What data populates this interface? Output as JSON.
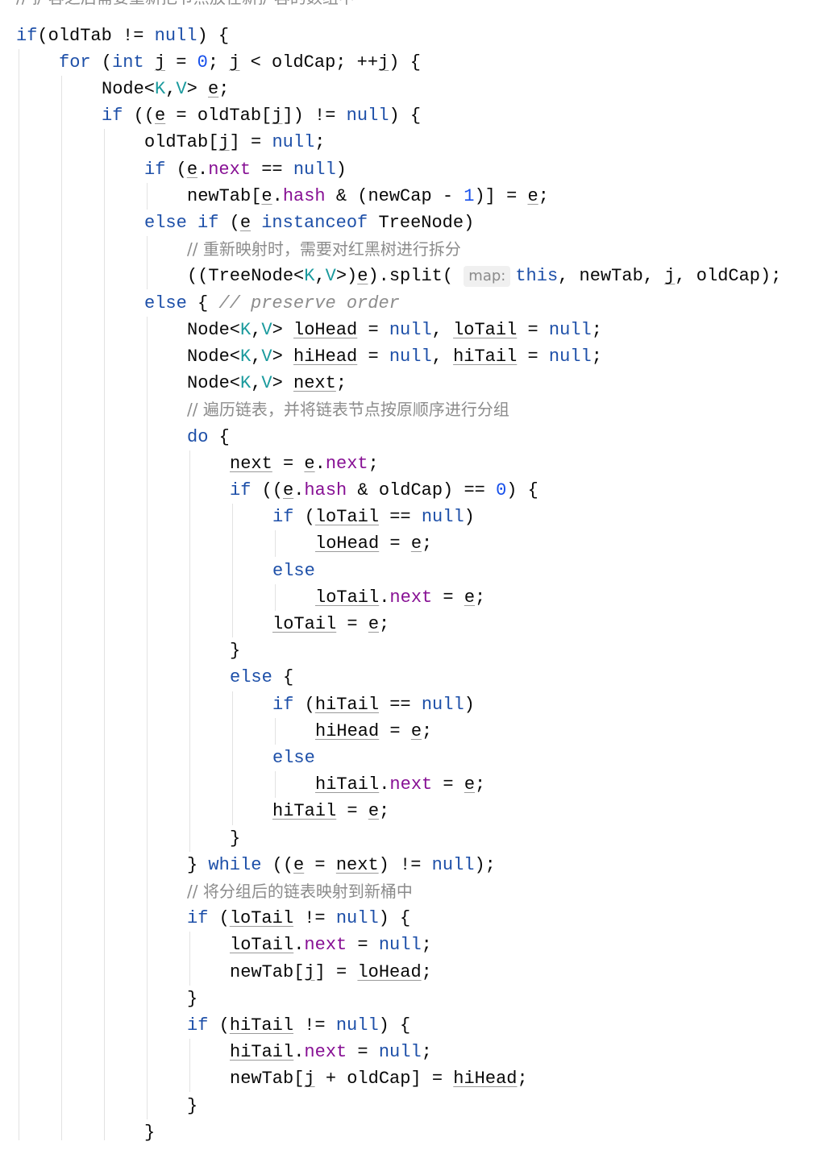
{
  "editor": {
    "language": "java",
    "clipped_comment": "// 扩容之后需要重新把节点放在新扩容的数组中",
    "lines": [
      {
        "indent": 0,
        "tokens": [
          [
            "kw",
            "if"
          ],
          [
            "",
            "(oldTab != "
          ],
          [
            "kw",
            "null"
          ],
          [
            "",
            ") {"
          ]
        ]
      },
      {
        "indent": 1,
        "tokens": [
          [
            "kw",
            "for"
          ],
          [
            "",
            " ("
          ],
          [
            "kw",
            "int"
          ],
          [
            "",
            " "
          ],
          [
            "ul",
            "j"
          ],
          [
            "",
            " = "
          ],
          [
            "num",
            "0"
          ],
          [
            "",
            "; "
          ],
          [
            "ul",
            "j"
          ],
          [
            "",
            " < oldCap; ++"
          ],
          [
            "ul",
            "j"
          ],
          [
            "",
            ") {"
          ]
        ]
      },
      {
        "indent": 2,
        "tokens": [
          [
            "",
            "Node<"
          ],
          [
            "tp",
            "K"
          ],
          [
            "",
            ","
          ],
          [
            "tp",
            "V"
          ],
          [
            "",
            "> "
          ],
          [
            "ul",
            "e"
          ],
          [
            "",
            ";"
          ]
        ]
      },
      {
        "indent": 2,
        "tokens": [
          [
            "kw",
            "if"
          ],
          [
            "",
            " (("
          ],
          [
            "ul",
            "e"
          ],
          [
            "",
            " = oldTab["
          ],
          [
            "ul",
            "j"
          ],
          [
            "",
            "]) != "
          ],
          [
            "kw",
            "null"
          ],
          [
            "",
            ") {"
          ]
        ]
      },
      {
        "indent": 3,
        "tokens": [
          [
            "",
            "oldTab["
          ],
          [
            "ul",
            "j"
          ],
          [
            "",
            "] = "
          ],
          [
            "kw",
            "null"
          ],
          [
            "",
            ";"
          ]
        ]
      },
      {
        "indent": 3,
        "tokens": [
          [
            "kw",
            "if"
          ],
          [
            "",
            " ("
          ],
          [
            "ul",
            "e"
          ],
          [
            "",
            "."
          ],
          [
            "fld",
            "next"
          ],
          [
            "",
            " == "
          ],
          [
            "kw",
            "null"
          ],
          [
            "",
            ")"
          ]
        ]
      },
      {
        "indent": 4,
        "tokens": [
          [
            "",
            "newTab["
          ],
          [
            "ul",
            "e"
          ],
          [
            "",
            "."
          ],
          [
            "fld",
            "hash"
          ],
          [
            "",
            " & (newCap - "
          ],
          [
            "num",
            "1"
          ],
          [
            "",
            ")] = "
          ],
          [
            "ul",
            "e"
          ],
          [
            "",
            ";"
          ]
        ]
      },
      {
        "indent": 3,
        "tokens": [
          [
            "kw",
            "else if"
          ],
          [
            "",
            " ("
          ],
          [
            "ul",
            "e"
          ],
          [
            "",
            " "
          ],
          [
            "kw",
            "instanceof"
          ],
          [
            "",
            " TreeNode)"
          ]
        ]
      },
      {
        "indent": 4,
        "tokens": [
          [
            "cmt",
            "// 重新映射时，需要对红黑树进行拆分"
          ]
        ]
      },
      {
        "indent": 4,
        "tokens": [
          [
            "",
            "((TreeNode<"
          ],
          [
            "tp",
            "K"
          ],
          [
            "",
            ","
          ],
          [
            "tp",
            "V"
          ],
          [
            "",
            ">)"
          ],
          [
            "ul",
            "e"
          ],
          [
            "",
            ").split( "
          ],
          [
            "hint",
            "map:"
          ],
          [
            "kw",
            "this"
          ],
          [
            "",
            ", newTab, "
          ],
          [
            "ul",
            "j"
          ],
          [
            "",
            ", oldCap);"
          ]
        ]
      },
      {
        "indent": 3,
        "tokens": [
          [
            "kw",
            "else"
          ],
          [
            "",
            " { "
          ],
          [
            "cmt-it",
            "// preserve order"
          ]
        ]
      },
      {
        "indent": 4,
        "tokens": [
          [
            "",
            "Node<"
          ],
          [
            "tp",
            "K"
          ],
          [
            "",
            ","
          ],
          [
            "tp",
            "V"
          ],
          [
            "",
            "> "
          ],
          [
            "ul",
            "loHead"
          ],
          [
            "",
            " = "
          ],
          [
            "kw",
            "null"
          ],
          [
            "",
            ", "
          ],
          [
            "ul",
            "loTail"
          ],
          [
            "",
            " = "
          ],
          [
            "kw",
            "null"
          ],
          [
            "",
            ";"
          ]
        ]
      },
      {
        "indent": 4,
        "tokens": [
          [
            "",
            "Node<"
          ],
          [
            "tp",
            "K"
          ],
          [
            "",
            ","
          ],
          [
            "tp",
            "V"
          ],
          [
            "",
            "> "
          ],
          [
            "ul",
            "hiHead"
          ],
          [
            "",
            " = "
          ],
          [
            "kw",
            "null"
          ],
          [
            "",
            ", "
          ],
          [
            "ul",
            "hiTail"
          ],
          [
            "",
            " = "
          ],
          [
            "kw",
            "null"
          ],
          [
            "",
            ";"
          ]
        ]
      },
      {
        "indent": 4,
        "tokens": [
          [
            "",
            "Node<"
          ],
          [
            "tp",
            "K"
          ],
          [
            "",
            ","
          ],
          [
            "tp",
            "V"
          ],
          [
            "",
            "> "
          ],
          [
            "ul",
            "next"
          ],
          [
            "",
            ";"
          ]
        ]
      },
      {
        "indent": 4,
        "tokens": [
          [
            "cmt",
            "// 遍历链表，并将链表节点按原顺序进行分组"
          ]
        ]
      },
      {
        "indent": 4,
        "tokens": [
          [
            "kw",
            "do"
          ],
          [
            "",
            " {"
          ]
        ]
      },
      {
        "indent": 5,
        "tokens": [
          [
            "ul",
            "next"
          ],
          [
            "",
            " = "
          ],
          [
            "ul",
            "e"
          ],
          [
            "",
            "."
          ],
          [
            "fld",
            "next"
          ],
          [
            "",
            ";"
          ]
        ]
      },
      {
        "indent": 5,
        "tokens": [
          [
            "kw",
            "if"
          ],
          [
            "",
            " (("
          ],
          [
            "ul",
            "e"
          ],
          [
            "",
            "."
          ],
          [
            "fld",
            "hash"
          ],
          [
            "",
            " & oldCap) == "
          ],
          [
            "num",
            "0"
          ],
          [
            "",
            ") {"
          ]
        ]
      },
      {
        "indent": 6,
        "tokens": [
          [
            "kw",
            "if"
          ],
          [
            "",
            " ("
          ],
          [
            "ul",
            "loTail"
          ],
          [
            "",
            " == "
          ],
          [
            "kw",
            "null"
          ],
          [
            "",
            ")"
          ]
        ]
      },
      {
        "indent": 7,
        "tokens": [
          [
            "ul",
            "loHead"
          ],
          [
            "",
            " = "
          ],
          [
            "ul",
            "e"
          ],
          [
            "",
            ";"
          ]
        ]
      },
      {
        "indent": 6,
        "tokens": [
          [
            "kw",
            "else"
          ]
        ]
      },
      {
        "indent": 7,
        "tokens": [
          [
            "ul",
            "loTail"
          ],
          [
            "",
            "."
          ],
          [
            "fld",
            "next"
          ],
          [
            "",
            " = "
          ],
          [
            "ul",
            "e"
          ],
          [
            "",
            ";"
          ]
        ]
      },
      {
        "indent": 6,
        "tokens": [
          [
            "ul",
            "loTail"
          ],
          [
            "",
            " = "
          ],
          [
            "ul",
            "e"
          ],
          [
            "",
            ";"
          ]
        ]
      },
      {
        "indent": 5,
        "tokens": [
          [
            "",
            "}"
          ]
        ]
      },
      {
        "indent": 5,
        "tokens": [
          [
            "kw",
            "else"
          ],
          [
            "",
            " {"
          ]
        ]
      },
      {
        "indent": 6,
        "tokens": [
          [
            "kw",
            "if"
          ],
          [
            "",
            " ("
          ],
          [
            "ul",
            "hiTail"
          ],
          [
            "",
            " == "
          ],
          [
            "kw",
            "null"
          ],
          [
            "",
            ")"
          ]
        ]
      },
      {
        "indent": 7,
        "tokens": [
          [
            "ul",
            "hiHead"
          ],
          [
            "",
            " = "
          ],
          [
            "ul",
            "e"
          ],
          [
            "",
            ";"
          ]
        ]
      },
      {
        "indent": 6,
        "tokens": [
          [
            "kw",
            "else"
          ]
        ]
      },
      {
        "indent": 7,
        "tokens": [
          [
            "ul",
            "hiTail"
          ],
          [
            "",
            "."
          ],
          [
            "fld",
            "next"
          ],
          [
            "",
            " = "
          ],
          [
            "ul",
            "e"
          ],
          [
            "",
            ";"
          ]
        ]
      },
      {
        "indent": 6,
        "tokens": [
          [
            "ul",
            "hiTail"
          ],
          [
            "",
            " = "
          ],
          [
            "ul",
            "e"
          ],
          [
            "",
            ";"
          ]
        ]
      },
      {
        "indent": 5,
        "tokens": [
          [
            "",
            "}"
          ]
        ]
      },
      {
        "indent": 4,
        "tokens": [
          [
            "",
            "} "
          ],
          [
            "kw",
            "while"
          ],
          [
            "",
            " (("
          ],
          [
            "ul",
            "e"
          ],
          [
            "",
            " = "
          ],
          [
            "ul",
            "next"
          ],
          [
            "",
            ") != "
          ],
          [
            "kw",
            "null"
          ],
          [
            "",
            ");"
          ]
        ]
      },
      {
        "indent": 4,
        "tokens": [
          [
            "cmt",
            "// 将分组后的链表映射到新桶中"
          ]
        ]
      },
      {
        "indent": 4,
        "tokens": [
          [
            "kw",
            "if"
          ],
          [
            "",
            " ("
          ],
          [
            "ul",
            "loTail"
          ],
          [
            "",
            " != "
          ],
          [
            "kw",
            "null"
          ],
          [
            "",
            ") {"
          ]
        ]
      },
      {
        "indent": 5,
        "tokens": [
          [
            "ul",
            "loTail"
          ],
          [
            "",
            "."
          ],
          [
            "fld",
            "next"
          ],
          [
            "",
            " = "
          ],
          [
            "kw",
            "null"
          ],
          [
            "",
            ";"
          ]
        ]
      },
      {
        "indent": 5,
        "tokens": [
          [
            "",
            "newTab["
          ],
          [
            "ul",
            "j"
          ],
          [
            "",
            "] = "
          ],
          [
            "ul",
            "loHead"
          ],
          [
            "",
            ";"
          ]
        ]
      },
      {
        "indent": 4,
        "tokens": [
          [
            "",
            "}"
          ]
        ]
      },
      {
        "indent": 4,
        "tokens": [
          [
            "kw",
            "if"
          ],
          [
            "",
            " ("
          ],
          [
            "ul",
            "hiTail"
          ],
          [
            "",
            " != "
          ],
          [
            "kw",
            "null"
          ],
          [
            "",
            ") {"
          ]
        ]
      },
      {
        "indent": 5,
        "tokens": [
          [
            "ul",
            "hiTail"
          ],
          [
            "",
            "."
          ],
          [
            "fld",
            "next"
          ],
          [
            "",
            " = "
          ],
          [
            "kw",
            "null"
          ],
          [
            "",
            ";"
          ]
        ]
      },
      {
        "indent": 5,
        "tokens": [
          [
            "",
            "newTab["
          ],
          [
            "ul",
            "j"
          ],
          [
            "",
            " + oldCap] = "
          ],
          [
            "ul",
            "hiHead"
          ],
          [
            "",
            ";"
          ]
        ]
      },
      {
        "indent": 4,
        "tokens": [
          [
            "",
            "}"
          ]
        ]
      },
      {
        "indent": 3,
        "tokens": [
          [
            "",
            "}"
          ]
        ]
      }
    ]
  },
  "colors": {
    "keyword": "#1d4fa8",
    "number": "#1750eb",
    "type_param": "#1a9a9d",
    "field": "#871094",
    "comment": "#8c8c8c",
    "text": "#080808",
    "inlay_hint_bg": "#f0f0f0",
    "indent_guide": "#e2e2e2"
  }
}
